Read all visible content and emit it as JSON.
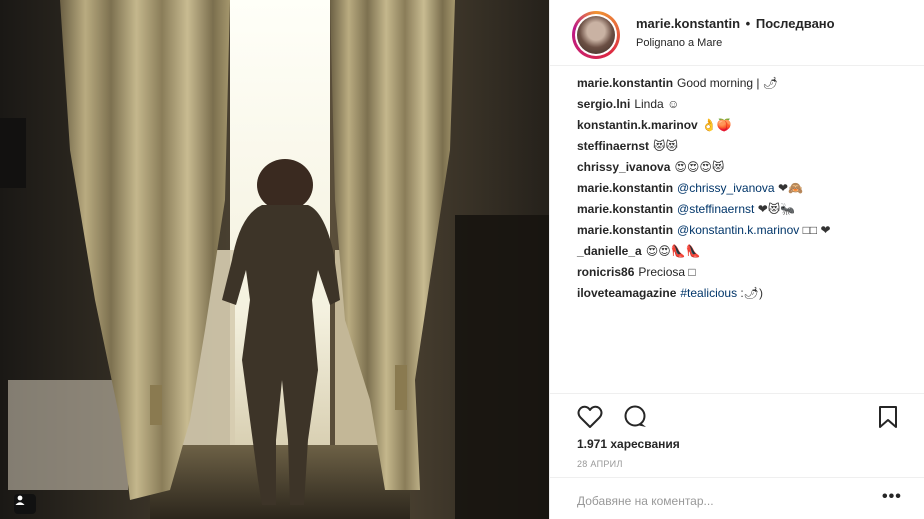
{
  "post": {
    "username": "marie.konstantin",
    "separator": "•",
    "follow_status": "Последвано",
    "location": "Polignano a Mare"
  },
  "comments": [
    {
      "user": "marie.konstantin",
      "text": "Good morning |",
      "emoji": "🌶"
    },
    {
      "user": "sergio.lni",
      "text": "Linda",
      "emoji": "☺"
    },
    {
      "user": "konstantin.k.marinov",
      "text": "",
      "emoji": "👌🍑"
    },
    {
      "user": "steffinaernst",
      "text": "",
      "emoji": "😻😻"
    },
    {
      "user": "chrissy_ivanova",
      "text": "",
      "emoji": "😍😍😍😻"
    },
    {
      "user": "marie.konstantin",
      "mention": "@chrissy_ivanova",
      "emoji": "❤🙈"
    },
    {
      "user": "marie.konstantin",
      "mention": "@steffinaernst",
      "emoji": "❤😻🐜"
    },
    {
      "user": "marie.konstantin",
      "mention": "@konstantin.k.marinov",
      "emoji": "□□ ❤"
    },
    {
      "user": "_danielle_a",
      "text": "",
      "emoji": "😍😍👠👠"
    },
    {
      "user": "ronicris86",
      "text": "Preciosa",
      "emoji": "□"
    },
    {
      "user": "iloveteamagazine",
      "mention": "#tealicious",
      "emoji": ":🌶)"
    }
  ],
  "actions": {
    "like_icon": "heart-icon",
    "comment_icon": "comment-icon",
    "save_icon": "bookmark-icon"
  },
  "likes_text": "1.971 харесвания",
  "date_text": "28 АПРИЛ",
  "add_comment_placeholder": "Добавяне на коментар...",
  "more_label": "•••",
  "colors": {
    "mention": "#003569",
    "muted": "#999999",
    "text": "#262626"
  }
}
